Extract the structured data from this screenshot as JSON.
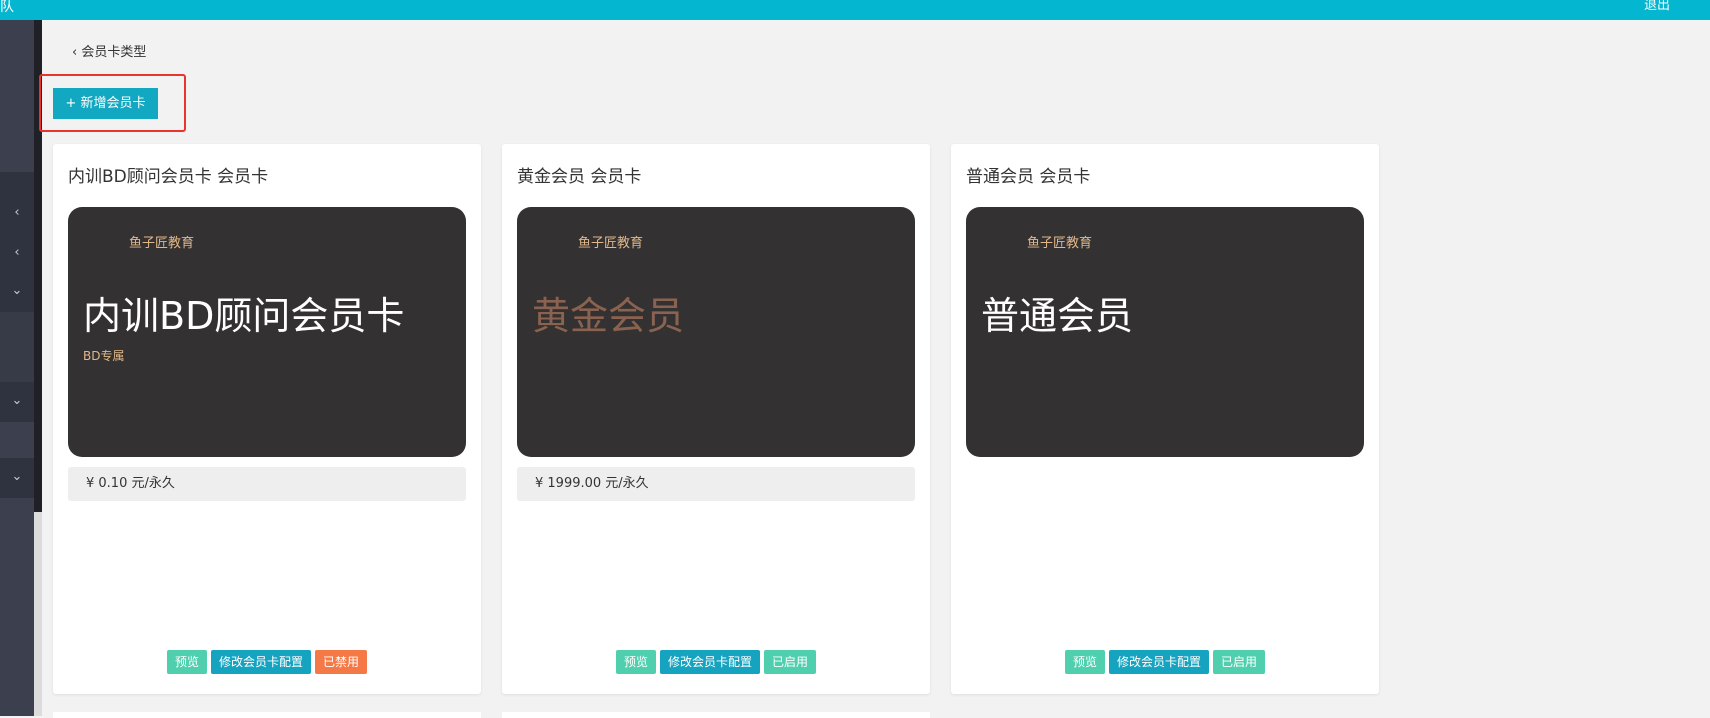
{
  "header": {
    "brand_fragment": "队",
    "user_fragment": "退出"
  },
  "sidebar": {
    "arrows": [
      "‹",
      "‹",
      "⌄",
      "⌄",
      "⌄"
    ]
  },
  "breadcrumb": {
    "back_label": "‹ 会员卡类型"
  },
  "toolbar": {
    "add_label": "+ 新增会员卡"
  },
  "cards": [
    {
      "title": "内训BD顾问会员卡 会员卡",
      "org": "鱼子匠教育",
      "name": "内训BD顾问会员卡",
      "subtitle": "BD专属",
      "price": "¥  0.10 元/永久",
      "name_color": "#ffffff",
      "actions": {
        "preview": "预览",
        "config": "修改会员卡配置",
        "status": "已禁用"
      }
    },
    {
      "title": "黄金会员 会员卡",
      "org": "鱼子匠教育",
      "name": "黄金会员",
      "subtitle": "",
      "price": "¥  1999.00 元/永久",
      "name_color": "#8a6350",
      "actions": {
        "preview": "预览",
        "config": "修改会员卡配置",
        "status": "已启用"
      }
    },
    {
      "title": "普通会员 会员卡",
      "org": "鱼子匠教育",
      "name": "普通会员",
      "subtitle": "",
      "price": "",
      "name_color": "#ffffff",
      "actions": {
        "preview": "预览",
        "config": "修改会员卡配置",
        "status": "已启用"
      }
    }
  ]
}
